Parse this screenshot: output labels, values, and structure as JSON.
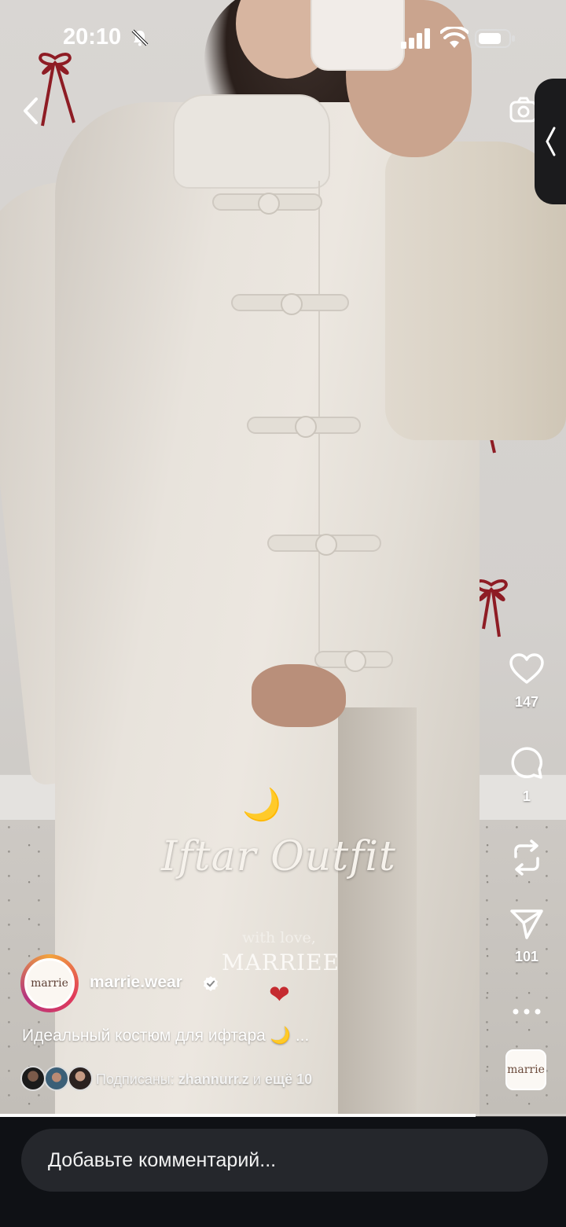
{
  "status_bar": {
    "time": "20:10",
    "icons": [
      "bell-off-icon",
      "signal-icon",
      "wifi-icon",
      "battery-icon"
    ]
  },
  "nav": {
    "back_icon": "chevron-left-icon",
    "camera_icon": "camera-icon",
    "side_panel_icon": "chevron-left-icon"
  },
  "media": {
    "overlay_script_title": "Iftar Outfit",
    "overlay_subtitle": "with love,",
    "overlay_brand": "MARRIEE",
    "overlay_moon": "🌙",
    "overlay_heart": "❤"
  },
  "actions": {
    "like_count": "147",
    "comment_count": "1",
    "share_count": "101",
    "like_icon": "heart-outline-icon",
    "comment_icon": "speech-bubble-icon",
    "repost_icon": "repost-icon",
    "share_icon": "paper-plane-icon",
    "more_icon": "more-horizontal-icon",
    "audio_thumb_text": "marrie"
  },
  "author": {
    "username": "marrie.wear",
    "avatar_text": "marrie",
    "verified": true
  },
  "caption": {
    "text": "Идеальный костюм для ифтара 🌙",
    "more": "..."
  },
  "followed_by": {
    "prefix": "Подписаны:",
    "name": "zhannurr.z",
    "connector": "и",
    "others": "ещё 10"
  },
  "progress": {
    "played_fraction": 0.84
  },
  "comment": {
    "placeholder": "Добавьте комментарий..."
  },
  "colors": {
    "accent_heart": "#c52b30",
    "story_ring": [
      "#f2a43c",
      "#e0395b",
      "#b5367e"
    ],
    "bottom_bar": "#0f1115",
    "input_bg": "#25272c"
  }
}
